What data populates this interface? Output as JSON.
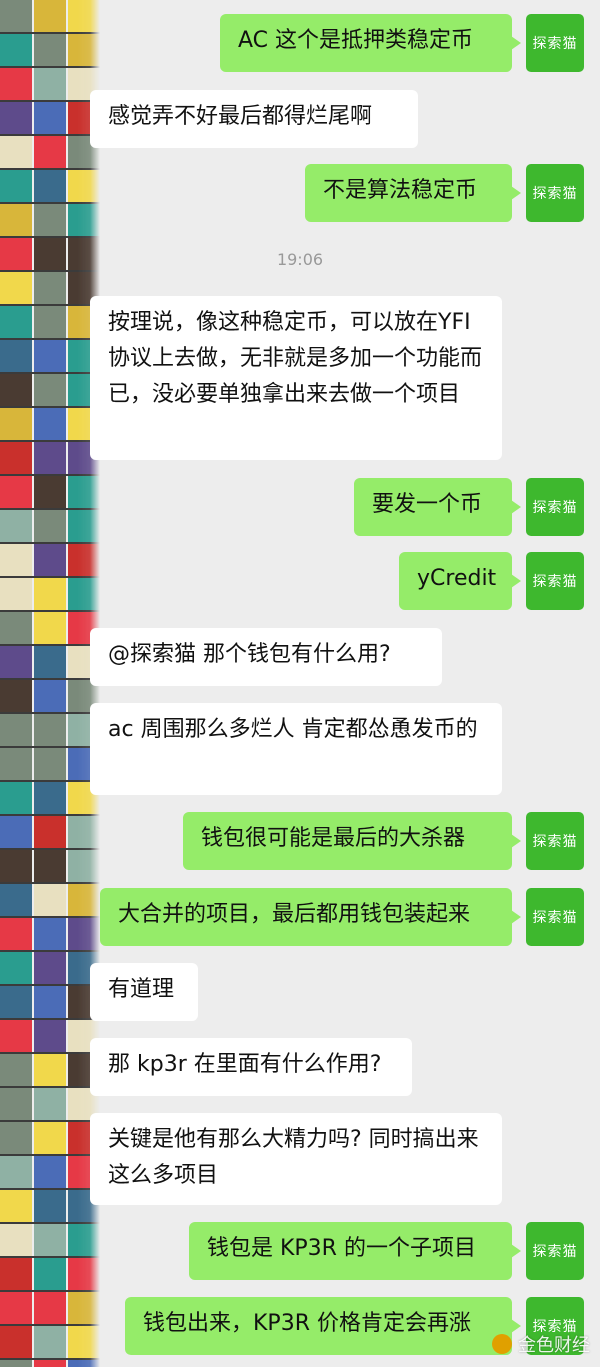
{
  "avatar_label": "探索猫",
  "timestamp": "19:06",
  "watermark": "金色财经",
  "messages": [
    {
      "side": "out",
      "text": "AC 这个是抵押类稳定币"
    },
    {
      "side": "in",
      "text": "感觉弄不好最后都得烂尾啊"
    },
    {
      "side": "out",
      "text": "不是算法稳定币"
    },
    {
      "side": "in",
      "text": "按理说，像这种稳定币，可以放在YFI 协议上去做，无非就是多加一个功能而已，没必要单独拿出来去做一个项目"
    },
    {
      "side": "out",
      "text": "要发一个币"
    },
    {
      "side": "out",
      "text": "yCredit"
    },
    {
      "side": "in",
      "text": "@探索猫  那个钱包有什么用?"
    },
    {
      "side": "in",
      "text": "ac 周围那么多烂人 肯定都怂恿发币的"
    },
    {
      "side": "out",
      "text": "钱包很可能是最后的大杀器"
    },
    {
      "side": "out",
      "text": "大合并的项目，最后都用钱包装起来"
    },
    {
      "side": "in",
      "text": "有道理"
    },
    {
      "side": "in",
      "text": "那 kp3r 在里面有什么作用?"
    },
    {
      "side": "in",
      "text": "关键是他有那么大精力吗? 同时搞出来这么多项目"
    },
    {
      "side": "out",
      "text": "钱包是 KP3R 的一个子项目"
    },
    {
      "side": "out",
      "text": "钱包出来，KP3R 价格肯定会再涨"
    }
  ]
}
